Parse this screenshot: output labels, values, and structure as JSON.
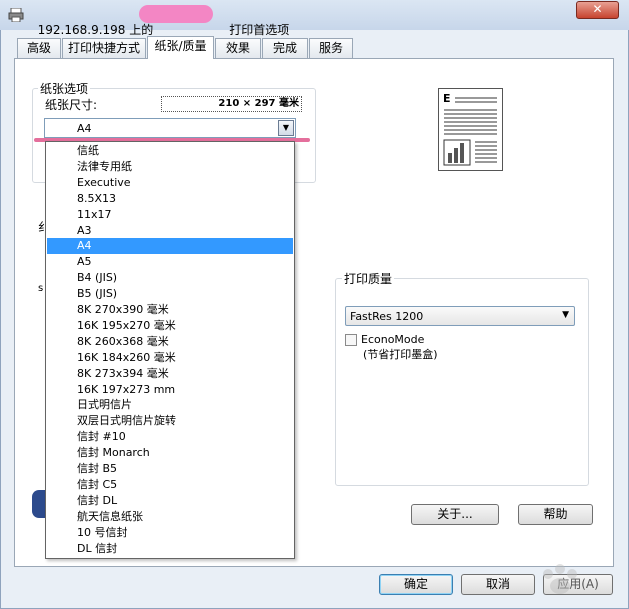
{
  "window": {
    "title_prefix": "192.168.9.198 上的",
    "title_suffix": "打印首选项",
    "close_glyph": "✕"
  },
  "tabs": [
    {
      "label": "高级"
    },
    {
      "label": "打印快捷方式"
    },
    {
      "label": "纸张/质量"
    },
    {
      "label": "效果"
    },
    {
      "label": "完成"
    },
    {
      "label": "服务"
    }
  ],
  "paper_options": {
    "group_label": "纸张选项",
    "size_label": "纸张尺寸:",
    "size_value": "210 × 297 毫米",
    "selected": "A4",
    "items": [
      "信纸",
      "法律专用纸",
      "Executive",
      "8.5X13",
      "11x17",
      "A3",
      "A4",
      "A5",
      "B4 (JIS)",
      "B5 (JIS)",
      "8K 270x390 毫米",
      "16K 195x270 毫米",
      "8K 260x368 毫米",
      "16K 184x260 毫米",
      "8K 273x394 毫米",
      "16K 197x273 mm",
      "日式明信片",
      "双层日式明信片旋转",
      "信封 #10",
      "信封 Monarch",
      "信封 B5",
      "信封 C5",
      "信封 DL",
      "航天信息纸张",
      "10 号信封",
      "DL 信封"
    ],
    "selected_index": 6
  },
  "preview": {
    "letter": "E"
  },
  "print_quality": {
    "group_label": "打印质量",
    "selected": "FastRes 1200",
    "econo_label": "EconoMode",
    "econo_sub": "(节省打印墨盒)",
    "econo_checked": false
  },
  "partial_labels": {
    "a": "纟",
    "b": "纟"
  },
  "buttons": {
    "about": "关于...",
    "help": "帮助",
    "ok": "确定",
    "cancel": "取消",
    "apply": "应用(A)"
  },
  "watermark": {
    "text": "Bai 经验"
  },
  "colors": {
    "selection": "#3399ff",
    "redaction": "#f386c4",
    "annotation": "#e46f9c"
  }
}
